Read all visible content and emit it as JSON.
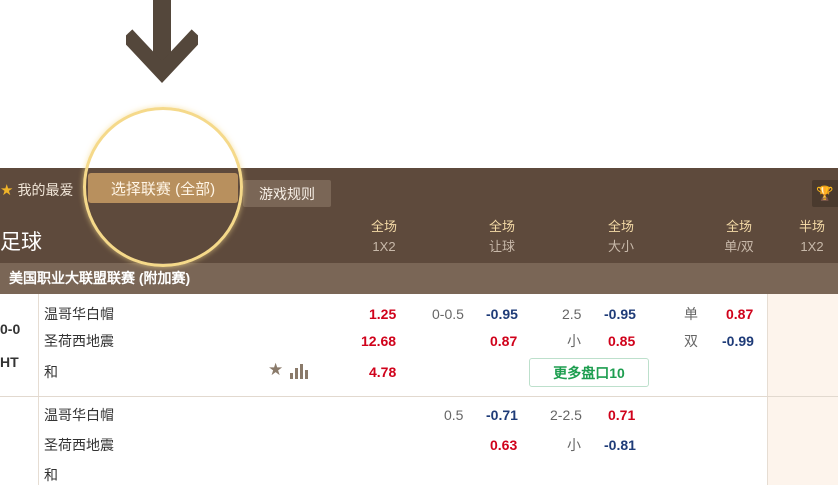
{
  "toolbar": {
    "favorites_label": "我的最爱",
    "league_select_label": "选择联赛 (全部)",
    "rules_label": "游戏规则",
    "trophy_icon": "trophy-icon"
  },
  "header": {
    "sport": "足球",
    "columns": [
      {
        "l1": "全场",
        "l2": "1X2"
      },
      {
        "l1": "全场",
        "l2": "让球"
      },
      {
        "l1": "全场",
        "l2": "大小"
      },
      {
        "l1": "全场",
        "l2": "单/双"
      },
      {
        "l1": "半场",
        "l2": "1X2"
      }
    ]
  },
  "league": "美国职业大联盟联赛 (附加赛)",
  "match1": {
    "score": "0-0",
    "time": "HT",
    "teams": [
      "温哥华白帽",
      "圣荷西地震",
      "和"
    ],
    "x12": [
      "1.25",
      "12.68",
      "4.78"
    ],
    "hdp_line": "0-0.5",
    "hdp": [
      "-0.95",
      "0.87"
    ],
    "ou_line": "2.5",
    "ou_under": "小",
    "ou": [
      "-0.95",
      "0.85"
    ],
    "oe_labels": [
      "单",
      "双"
    ],
    "oe": [
      "0.87",
      "-0.99"
    ],
    "more_label": "更多盘口10"
  },
  "match2": {
    "teams": [
      "温哥华白帽",
      "圣荷西地震",
      "和"
    ],
    "hdp_line": "0.5",
    "hdp": [
      "-0.71",
      "0.63"
    ],
    "ou_line": "2-2.5",
    "ou_under": "小",
    "ou": [
      "0.71",
      "-0.81"
    ]
  },
  "colors": {
    "header_bg": "#5e4a3c",
    "league_bar_bg": "#7a6656",
    "accent_gold": "#b8905e",
    "odds_red": "#d0021b",
    "odds_blue": "#1e3b78",
    "more_green": "#1e9e50",
    "highlight_ring": "#f5d98a"
  }
}
